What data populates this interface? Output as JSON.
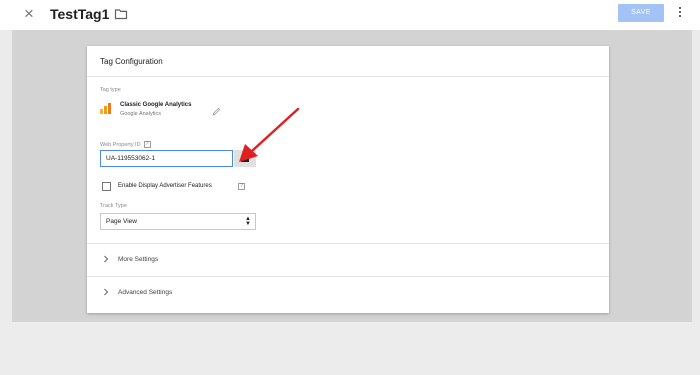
{
  "topbar": {
    "close_icon": "×",
    "tag_name": "TestTag1",
    "save_label": "SAVE"
  },
  "card": {
    "title": "Tag Configuration",
    "tag_type": {
      "label": "Tag type",
      "name": "Classic Google Analytics",
      "subtitle": "Google Analytics"
    },
    "web_property": {
      "label": "Web Property ID",
      "help": "?",
      "value": "UA-119553062-1"
    },
    "display_features": {
      "label": "Enable Display Advertiser Features",
      "help": "?",
      "checked": false
    },
    "track_type": {
      "label": "Track Type",
      "value": "Page View"
    },
    "sections": [
      {
        "label": "More Settings"
      },
      {
        "label": "Advanced Settings"
      }
    ]
  },
  "colors": {
    "save_button": "#a3c2f5",
    "input_focus": "#4a87ee",
    "annotation_arrow": "#e02020",
    "ga_orange": "#f29c1f"
  },
  "icons": {
    "close": "close-icon",
    "folder": "folder-icon",
    "more": "more-vert-icon",
    "edit": "pencil-icon",
    "variable": "variable-block-icon",
    "chevron": "chevron-right-icon"
  }
}
